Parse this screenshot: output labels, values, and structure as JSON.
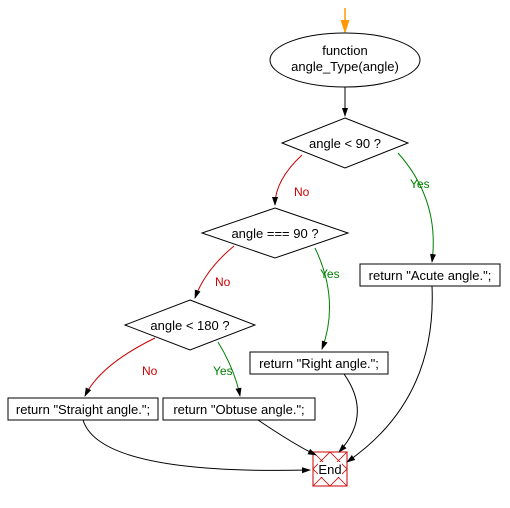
{
  "start": {
    "line1": "function",
    "line2": "angle_Type(angle)"
  },
  "decisions": {
    "d1": "angle < 90 ?",
    "d2": "angle === 90 ?",
    "d3": "angle < 180 ?"
  },
  "returns": {
    "acute": "return \"Acute angle.\";",
    "right": "return \"Right angle.\";",
    "obtuse": "return \"Obtuse angle.\";",
    "straight": "return \"Straight angle.\";"
  },
  "end": "End",
  "labels": {
    "yes": "Yes",
    "no": "No"
  }
}
